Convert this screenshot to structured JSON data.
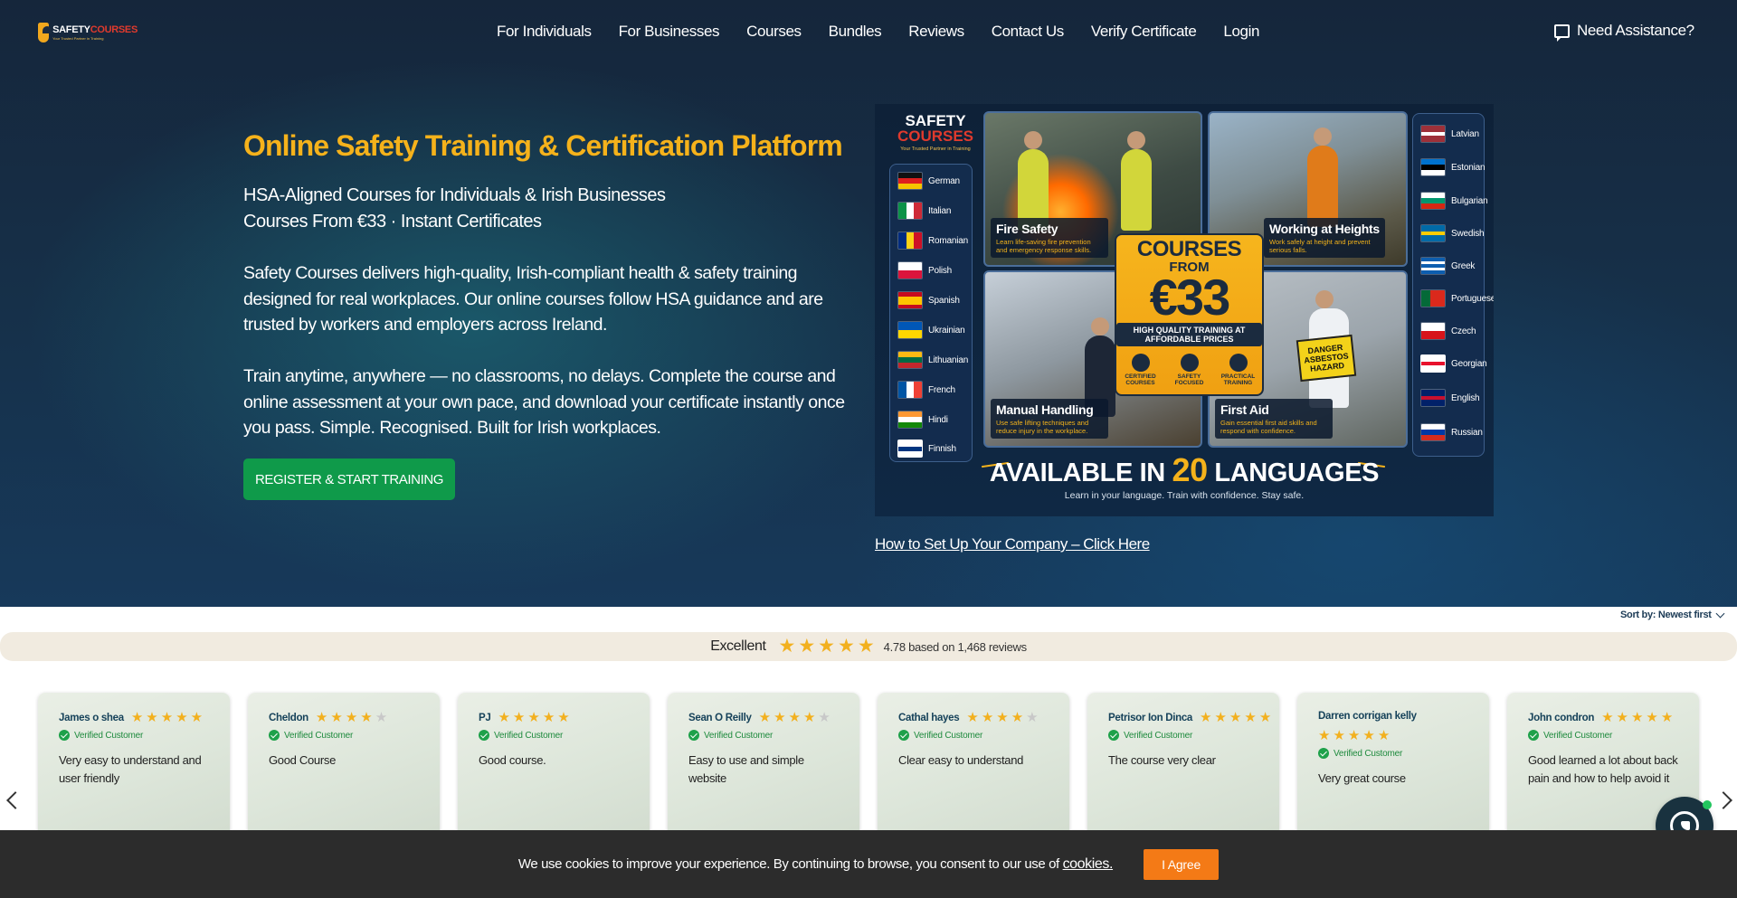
{
  "header": {
    "logo": {
      "text_main": "SAFETY",
      "text_accent": "COURSES",
      "tagline": "Your Trusted Partner in Training"
    },
    "nav": [
      "For Individuals",
      "For Businesses",
      "Courses",
      "Bundles",
      "Reviews",
      "Contact Us",
      "Verify Certificate",
      "Login"
    ],
    "assist_label": "Need Assistance?"
  },
  "hero": {
    "title": "Online Safety Training & Certification Platform",
    "subtitle_line1": "HSA-Aligned Courses for Individuals & Irish Businesses",
    "subtitle_line2": "Courses From €33 · Instant Certificates",
    "para1": "Safety Courses delivers high-quality, Irish-compliant health & safety training designed for real workplaces. Our online courses follow HSA guidance and are trusted by workers and employers across Ireland.",
    "para2": "Train anytime, anywhere — no classrooms, no delays. Complete the course and online assessment at your own pace, and download your certificate instantly once you pass. Simple. Recognised. Built for Irish workplaces.",
    "cta": "REGISTER & START TRAINING",
    "setup_link": "How to Set Up Your Company – Click Here"
  },
  "promo": {
    "logo_line1": "SAFETY",
    "logo_line2": "COURSES",
    "logo_tagline": "Your Trusted Partner in Training",
    "languages_left": [
      "German",
      "Italian",
      "Romanian",
      "Polish",
      "Spanish",
      "Ukrainian",
      "Lithuanian",
      "French",
      "Hindi",
      "Finnish"
    ],
    "languages_right": [
      "Latvian",
      "Estonian",
      "Bulgarian",
      "Swedish",
      "Greek",
      "Portuguese",
      "Czech",
      "Georgian",
      "English",
      "Russian"
    ],
    "tiles": [
      {
        "title": "Fire Safety",
        "desc": "Learn life-saving fire prevention and emergency response skills."
      },
      {
        "title": "Working at Heights",
        "desc": "Work safely at height and prevent serious falls."
      },
      {
        "title": "Manual Handling",
        "desc": "Use safe lifting techniques and reduce injury in the workplace."
      },
      {
        "title": "First Aid",
        "desc": "Gain essential first aid skills and respond with confidence."
      }
    ],
    "badge": {
      "line1": "COURSES",
      "line2": "FROM",
      "price": "€33",
      "banner": "HIGH QUALITY TRAINING AT AFFORDABLE PRICES",
      "icons": [
        "CERTIFIED COURSES",
        "SAFETY FOCUSED",
        "PRACTICAL TRAINING"
      ]
    },
    "danger_sign": "DANGER ASBESTOS HAZARD",
    "avail_pre": "AVAILABLE IN",
    "avail_num": "20",
    "avail_post": "LANGUAGES",
    "avail_sub": "Learn in your language. Train with confidence. Stay safe."
  },
  "reviews": {
    "sort_label": "Sort by: Newest first",
    "summary_label": "Excellent",
    "summary_stars": 5,
    "summary_text": "4.78 based on 1,468 reviews",
    "verified_label": "Verified Customer",
    "items": [
      {
        "name": "James o shea",
        "stars": 5,
        "text": "Very easy to understand and user friendly"
      },
      {
        "name": "Cheldon",
        "stars": 4,
        "text": "Good Course"
      },
      {
        "name": "PJ",
        "stars": 5,
        "text": "Good course."
      },
      {
        "name": "Sean O Reilly",
        "stars": 4,
        "text": "Easy to use and simple website"
      },
      {
        "name": "Cathal hayes",
        "stars": 4,
        "text": "Clear easy to understand"
      },
      {
        "name": "Petrisor Ion Dinca",
        "stars": 5,
        "text": "The course very clear"
      },
      {
        "name": "Darren corrigan kelly",
        "stars": 5,
        "text": "Very great course"
      },
      {
        "name": "John condron",
        "stars": 5,
        "text": "Good learned a lot about back pain and how to help avoid it"
      }
    ]
  },
  "cookie": {
    "text": "We use cookies to improve your experience. By continuing to browse, you consent to our use of",
    "link": "cookies.",
    "button": "I Agree"
  },
  "colors": {
    "accent_gold": "#f5b21b",
    "cta_green": "#0f9a4a",
    "cookie_orange": "#f47a16",
    "star": "#f2b01e"
  }
}
